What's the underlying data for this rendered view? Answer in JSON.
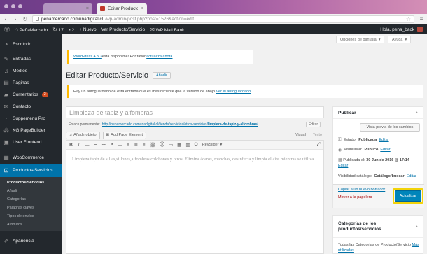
{
  "browser": {
    "tab_inactive_title": "",
    "tab_active_title": "Editar Producto/Servicio",
    "url_host": "penamercado.comunadigital.cl",
    "url_path": "/wp-admin/post.php?post=1526&action=edit"
  },
  "adminbar": {
    "site_name": "PeñaMercado",
    "updates_count": "17",
    "comments_count": "2",
    "new_label": "+ Nuevo",
    "view_label": "Ver Producto/Servicio",
    "wpmail_label": "WP Mail Bank",
    "greeting": "Hola, pena_back"
  },
  "sidebar": {
    "items": [
      {
        "label": "Escritorio",
        "icon": "dashboard-icon"
      },
      {
        "label": "Entradas",
        "icon": "pin-icon"
      },
      {
        "label": "Medios",
        "icon": "media-icon"
      },
      {
        "label": "Páginas",
        "icon": "pages-icon"
      },
      {
        "label": "Comentarios",
        "icon": "comments-icon",
        "badge": "2"
      },
      {
        "label": "Contacto",
        "icon": "mail-icon"
      },
      {
        "label": "Suppemenu Pro",
        "icon": "menu-icon"
      },
      {
        "label": "KG PageBuilder",
        "icon": "builder-icon"
      },
      {
        "label": "User Frontend",
        "icon": "user-icon"
      },
      {
        "label": "WooCommerce",
        "icon": "woo-icon"
      },
      {
        "label": "Productos/Servicios",
        "icon": "product-icon"
      }
    ],
    "submenu": [
      "Productos/Servicios",
      "Añadir",
      "Categorías",
      "Palabras claves",
      "Tipos de envíos",
      "Atributos"
    ],
    "bottom_item": "Apariencia"
  },
  "content": {
    "screen_options": "Opciones de pantalla",
    "help": "Ayuda",
    "update_notice_link": "WordPress 4.5.3",
    "update_notice_text": " está disponible! Por favor, ",
    "update_notice_link2": "actualiza ahora",
    "page_title": "Editar Producto/Servicio",
    "add_new": "Añadir",
    "autosave_text": "Hay un autoguardado de esta entrada que es más reciente que la versión de abajo. ",
    "autosave_link": "Ver el autoguardado",
    "post_title": "Limpieza de tapiz y alfombras",
    "permalink_label": "Enlace permanente:",
    "permalink_url": "http://penamercado.comunadigital.cl/tienda/servicios/otros-servicios/",
    "permalink_slug": "limpieza-de-tapiz-y-alfombras/",
    "permalink_edit": "Editar",
    "add_media": "Añadir objeto",
    "add_page_element": "Add Page Element",
    "tab_visual": "Visual",
    "tab_text": "Texto",
    "revslider": "RevSlider",
    "editor_text": "Limpieza tapiz de sillas,sillones,alfombras colchones y otros. Elimina ácaros, manchas, desinfecta y limpia el aire mientras se utiliza."
  },
  "publish": {
    "title": "Publicar",
    "preview_button": "Vista previa de los cambios",
    "status_label": "Estado:",
    "status_value": "Publicada",
    "visibility_label": "Visibilidad:",
    "visibility_value": "Público",
    "published_label": "Publicada el:",
    "published_value": "30 Jun de 2016 @ 17:14",
    "edit_link": "Editar",
    "catalog_label": "Visibilidad catálogo:",
    "catalog_value": "Catálogo/buscar",
    "copy_draft": "Copiar a un nuevo borrador",
    "trash": "Mover a la papelera",
    "update_button": "Actualizar"
  },
  "categories": {
    "title": "Categorías de los productos/servicios",
    "tab_all": "Todas las Categorías de Producto/Servicio",
    "tab_used": "Más utilizadas"
  }
}
